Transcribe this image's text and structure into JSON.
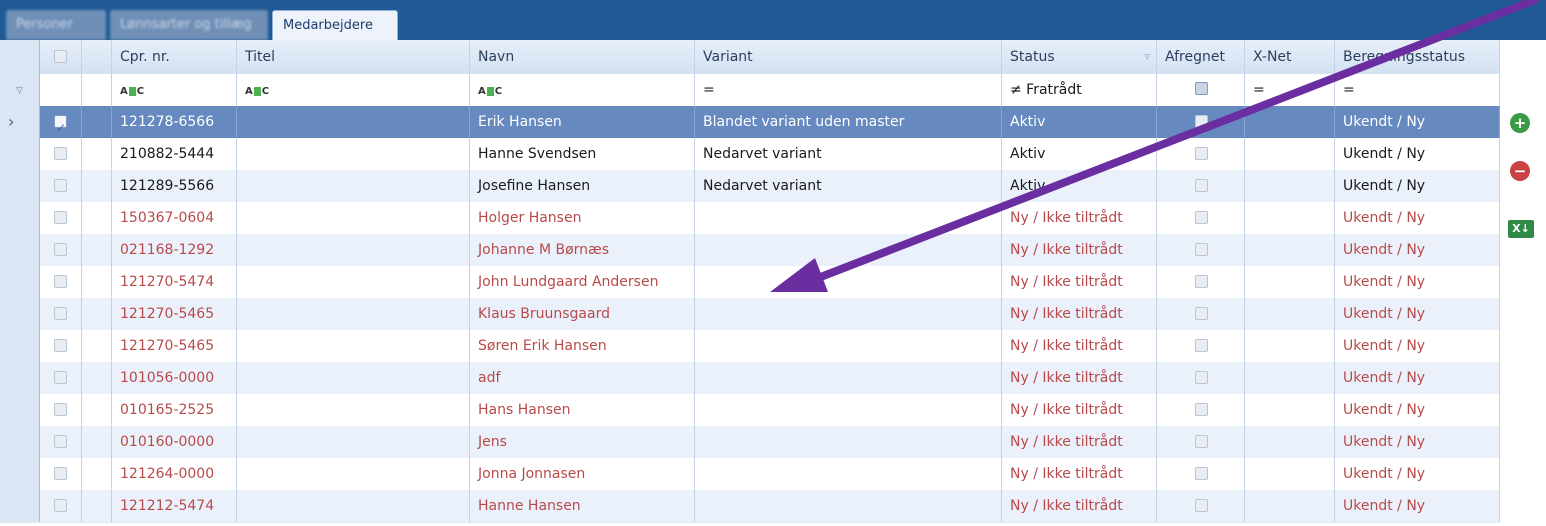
{
  "tabs": [
    {
      "label": "Personer"
    },
    {
      "label": "Lønnsarter og tillæg"
    },
    {
      "label": "Medarbejdere"
    }
  ],
  "columns": {
    "cpr": "Cpr. nr.",
    "titel": "Titel",
    "navn": "Navn",
    "variant": "Variant",
    "status": "Status",
    "afregnet": "Afregnet",
    "xnet": "X-Net",
    "beregning": "Beregningsstatus"
  },
  "filter": {
    "cpr": "ABC",
    "titel": "ABC",
    "navn": "ABC",
    "variant": "=",
    "status": "≠ Fratrådt",
    "xnet": "=",
    "beregning": "="
  },
  "rows": [
    {
      "cpr": "121278-6566",
      "titel": "",
      "navn": "Erik Hansen",
      "variant": "Blandet variant uden master",
      "status": "Aktiv",
      "beregning": "Ukendt / Ny",
      "selected": true,
      "checked": true
    },
    {
      "cpr": "210882-5444",
      "titel": "",
      "navn": "Hanne Svendsen",
      "variant": "Nedarvet variant",
      "status": "Aktiv",
      "beregning": "Ukendt / Ny"
    },
    {
      "cpr": "121289-5566",
      "titel": "",
      "navn": "Josefine Hansen",
      "variant": "Nedarvet variant",
      "status": "Aktiv",
      "beregning": "Ukendt / Ny"
    },
    {
      "cpr": "150367-0604",
      "titel": "",
      "navn": "Holger Hansen",
      "variant": "",
      "status": "Ny / Ikke tiltrådt",
      "beregning": "Ukendt / Ny"
    },
    {
      "cpr": "021168-1292",
      "titel": "",
      "navn": "Johanne M Børnæs",
      "variant": "",
      "status": "Ny / Ikke tiltrådt",
      "beregning": "Ukendt / Ny"
    },
    {
      "cpr": "121270-5474",
      "titel": "",
      "navn": "John Lundgaard Andersen",
      "variant": "",
      "status": "Ny / Ikke tiltrådt",
      "beregning": "Ukendt / Ny"
    },
    {
      "cpr": "121270-5465",
      "titel": "",
      "navn": "Klaus Bruunsgaard",
      "variant": "",
      "status": "Ny / Ikke tiltrådt",
      "beregning": "Ukendt / Ny"
    },
    {
      "cpr": "121270-5465",
      "titel": "",
      "navn": "Søren Erik Hansen",
      "variant": "",
      "status": "Ny / Ikke tiltrådt",
      "beregning": "Ukendt / Ny"
    },
    {
      "cpr": "101056-0000",
      "titel": "",
      "navn": "adf",
      "variant": "",
      "status": "Ny / Ikke tiltrådt",
      "beregning": "Ukendt / Ny"
    },
    {
      "cpr": "010165-2525",
      "titel": "",
      "navn": "Hans Hansen",
      "variant": "",
      "status": "Ny / Ikke tiltrådt",
      "beregning": "Ukendt / Ny"
    },
    {
      "cpr": "010160-0000",
      "titel": "",
      "navn": "Jens",
      "variant": "",
      "status": "Ny / Ikke tiltrådt",
      "beregning": "Ukendt / Ny"
    },
    {
      "cpr": "121264-0000",
      "titel": "",
      "navn": "Jonna Jonnasen",
      "variant": "",
      "status": "Ny / Ikke tiltrådt",
      "beregning": "Ukendt / Ny"
    },
    {
      "cpr": "121212-5474",
      "titel": "",
      "navn": "Hanne Hansen",
      "variant": "",
      "status": "Ny / Ikke tiltrådt",
      "beregning": "Ukendt / Ny"
    }
  ],
  "side": {
    "add_icon": "plus-circle-icon",
    "remove_icon": "minus-circle-icon",
    "export_icon": "excel-export-icon",
    "export_label": "X↓"
  },
  "colors": {
    "tabbar": "#1f5a96",
    "selected_row": "#6689c0",
    "new_row_text": "#b84a4a",
    "annotation_arrow": "#6a2ea0"
  }
}
